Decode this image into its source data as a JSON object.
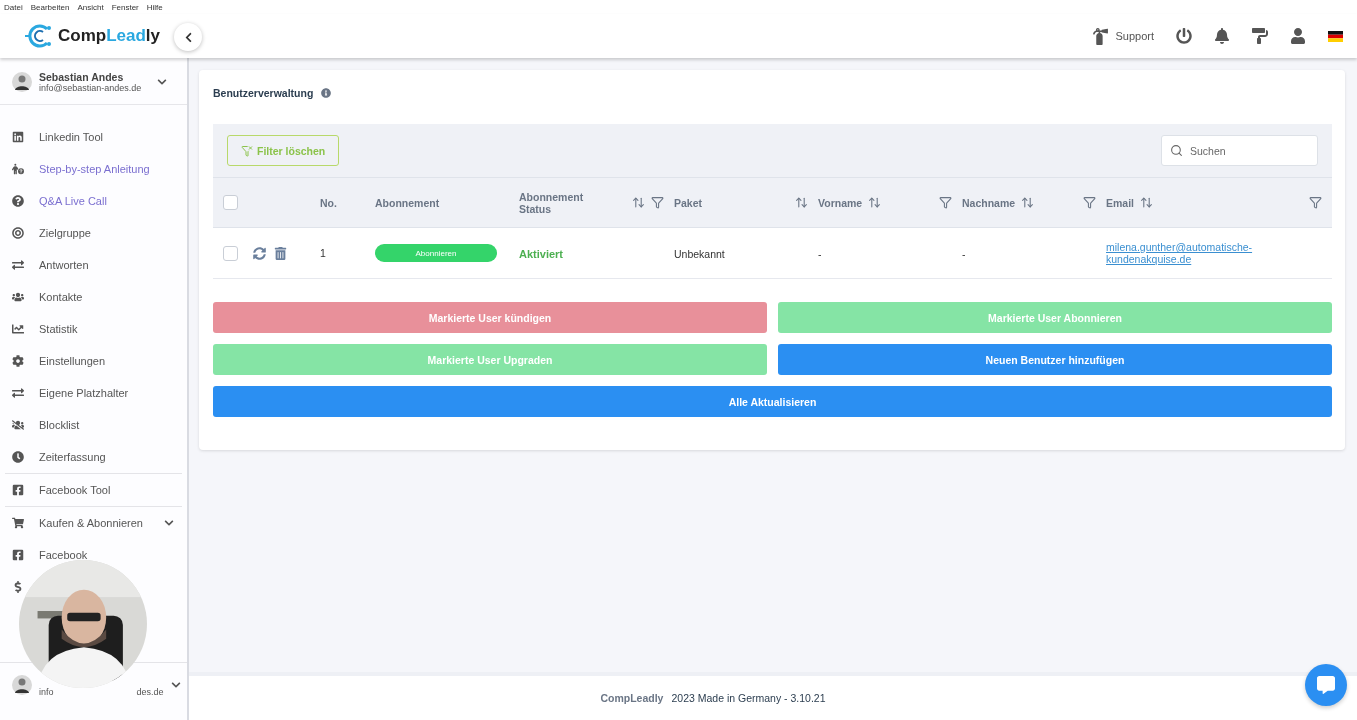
{
  "menu_bar": [
    "Datei",
    "Bearbeiten",
    "Ansicht",
    "Fenster",
    "Hilfe"
  ],
  "logo": {
    "parts": [
      {
        "text": "Comp",
        "accent": false
      },
      {
        "text": "Lead",
        "accent": true
      },
      {
        "text": "ly",
        "accent": false
      }
    ]
  },
  "header": {
    "support": "Support"
  },
  "profile": {
    "name": "Sebastian Andes",
    "email": "info@sebastian-andes.de"
  },
  "sidebar": {
    "groups": [
      [
        {
          "label": "Linkedin Tool",
          "highlighted": false
        },
        {
          "label": "Step-by-step Anleitung",
          "highlighted": true
        },
        {
          "label": "Q&A Live Call",
          "highlighted": true
        },
        {
          "label": "Zielgruppe",
          "highlighted": false
        },
        {
          "label": "Antworten",
          "highlighted": false
        },
        {
          "label": "Kontakte",
          "highlighted": false
        },
        {
          "label": "Statistik",
          "highlighted": false
        },
        {
          "label": "Einstellungen",
          "highlighted": false
        },
        {
          "label": "Eigene Platzhalter",
          "highlighted": false
        },
        {
          "label": "Blocklist",
          "highlighted": false
        },
        {
          "label": "Zeiterfassung",
          "highlighted": false
        }
      ],
      [
        {
          "label": "Facebook Tool",
          "highlighted": false
        }
      ],
      [
        {
          "label": "Kaufen & Abonnieren",
          "highlighted": false,
          "kind": "dropdown"
        },
        {
          "label": "Facebook",
          "highlighted": false
        },
        {
          "kind": "covered"
        }
      ]
    ]
  },
  "bottom_profile": {
    "email_start": "info",
    "email_end": "des.de"
  },
  "page": {
    "title": "Benutzerverwaltung"
  },
  "toolbar": {
    "clear_filter": "Filter löschen",
    "search": {
      "placeholder": "Suchen"
    }
  },
  "table": {
    "columns": [
      {
        "label": "No."
      },
      {
        "label": "Abonnement"
      },
      {
        "label": "Abonnement Status",
        "sort": true,
        "filter": true
      },
      {
        "label": "Paket",
        "sort": true
      },
      {
        "label": "Vorname",
        "sort": true,
        "filter": true
      },
      {
        "label": "Nachname",
        "sort": true,
        "filter": true
      },
      {
        "label": "Email",
        "sort": true,
        "filter": true
      }
    ],
    "header_checked": false,
    "rows": [
      {
        "checked": false,
        "no": "1",
        "subscription": "Abonnieren",
        "status": "Aktiviert",
        "package": "Unbekannt",
        "first_name": "-",
        "last_name": "-",
        "email": "milena.gunther@automatische-kundenakquise.de"
      }
    ]
  },
  "actions": [
    {
      "label": "Markierte User kündigen",
      "kind": "danger",
      "disabled": true,
      "wide": false
    },
    {
      "label": "Markierte User Abonnieren",
      "kind": "success",
      "disabled": true,
      "wide": false
    },
    {
      "label": "Markierte User Upgraden",
      "kind": "success",
      "disabled": true,
      "wide": false
    },
    {
      "label": "Neuen Benutzer hinzufügen",
      "kind": "primary",
      "disabled": false,
      "wide": false
    },
    {
      "label": "Alle Aktualisieren",
      "kind": "primary",
      "disabled": false,
      "wide": true
    }
  ],
  "footer": {
    "brand": "CompLeadly",
    "text": "2023 Made in Germany - 3.10.21"
  }
}
